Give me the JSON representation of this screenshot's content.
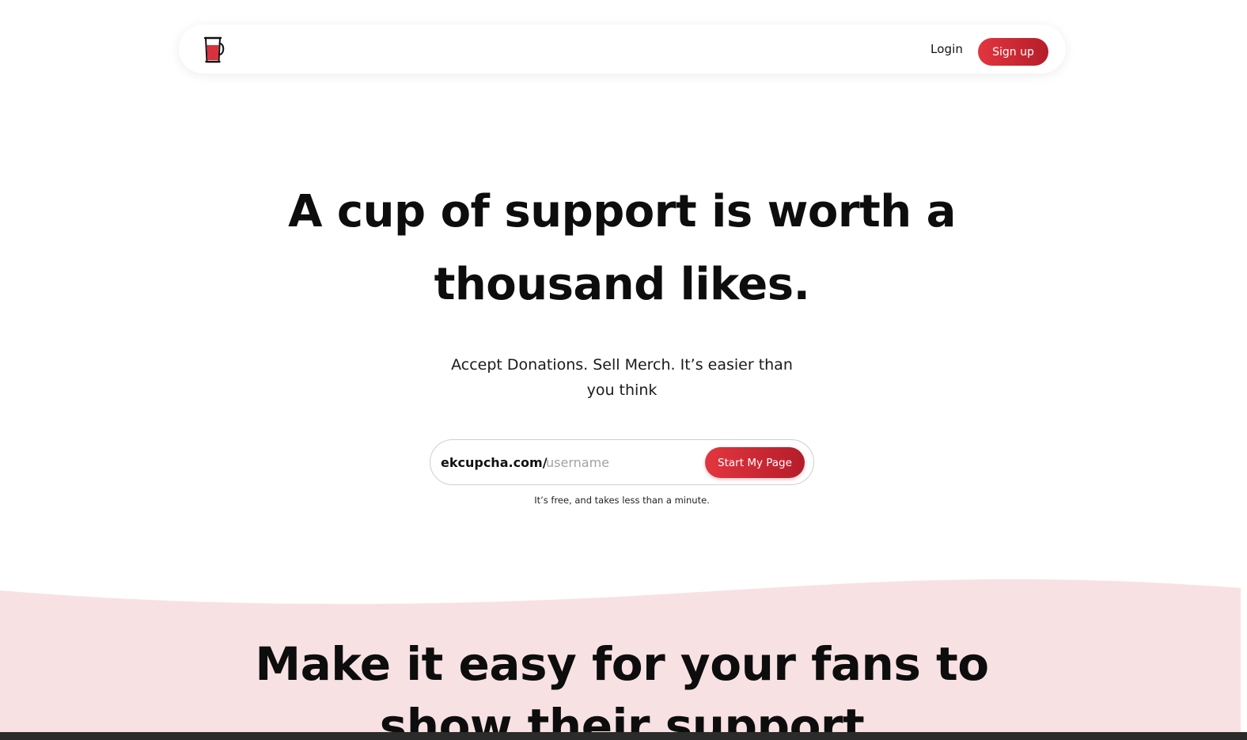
{
  "brand": {
    "logo_icon": "tea-glass-icon",
    "accent_color": "#d32a36",
    "accent_color_dark": "#b51d2a",
    "section_background": "#f8e1e3"
  },
  "nav": {
    "login_label": "Login",
    "signup_label": "Sign up"
  },
  "hero": {
    "title_line1": "A cup of support is worth a",
    "title_line2": "thousand likes.",
    "subtitle_line1": "Accept Donations. Sell Merch. It’s easier than",
    "subtitle_line2": "you think"
  },
  "signup_form": {
    "url_prefix": "ekcupcha.com/",
    "username_placeholder": "username",
    "username_value": "",
    "button_label": "Start My Page",
    "note": "It’s free, and takes less than a minute."
  },
  "features": {
    "title_line1": "Make it easy for your fans to",
    "title_line2": "show their support"
  }
}
